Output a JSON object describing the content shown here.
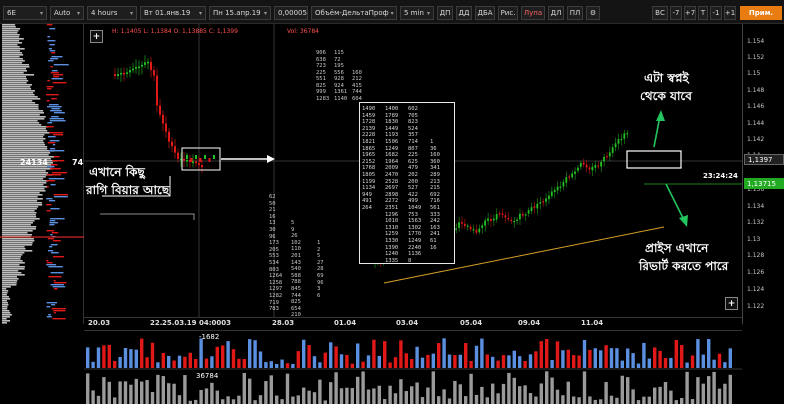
{
  "toolbar": {
    "symbol": "6E",
    "scale": "Auto",
    "period": "4 hours",
    "date_from": "Вт 01.янв.19",
    "date_to": "Пн 15.апр.19",
    "tick": "0,00005",
    "indicator": "Объём-ДельтаПроф",
    "interval": "5 min",
    "buttons": [
      "ДП",
      "ДД",
      "ДБА",
      "Рис.",
      "Лупа",
      "ДЛ",
      "ПЛ",
      "⚙"
    ],
    "active_button": "Лупа",
    "right_buttons": [
      "ВС",
      "-7",
      "+7",
      "T",
      "-1",
      "+1"
    ],
    "apply": "Прим."
  },
  "ohlc": "H: 1,1405 L: 1,1384 O: 1,13885 C: 1,1399",
  "ohlc_vol": "Vol: 36784",
  "profile": {
    "left_value": "24134",
    "right_value": "74"
  },
  "price_axis": {
    "ticks": [
      "1.154",
      "1.152",
      "1.15",
      "1.148",
      "1.146",
      "1.144",
      "1.142",
      "1.14",
      "1.136",
      "1.134",
      "1.132",
      "1.13",
      "1.128",
      "1.126",
      "1.124",
      "1.122"
    ],
    "crosshair_price": "1,1397",
    "current_price": "1,13715",
    "current_price_color": "#22aa22",
    "timer": "23:24:24"
  },
  "date_axis": [
    "20.03",
    "22.",
    "25.03.19 04:0003",
    "28.03",
    "01.04",
    "03.04",
    "05.04",
    "09.04",
    "11.04"
  ],
  "lower_panel": {
    "delta": "-1682",
    "volume": "36784"
  },
  "cluster": {
    "rows": [
      [
        "1490",
        "1400",
        "602",
        ""
      ],
      [
        "1459",
        "1789",
        "705",
        ""
      ],
      [
        "1728",
        "1830",
        "823",
        ""
      ],
      [
        "2139",
        "1449",
        "524",
        ""
      ],
      [
        "2228",
        "1193",
        "357",
        ""
      ],
      [
        "1821",
        "1506",
        "714",
        "1"
      ],
      [
        "1865",
        "1249",
        "807",
        "36"
      ],
      [
        "1965",
        "1682",
        "225",
        "160"
      ],
      [
        "2152",
        "1964",
        "625",
        "360"
      ],
      [
        "1768",
        "2009",
        "479",
        "341"
      ],
      [
        "1805",
        "2470",
        "202",
        "289"
      ],
      [
        "1199",
        "2528",
        "200",
        "213"
      ],
      [
        "1134",
        "2697",
        "527",
        "215"
      ],
      [
        "949",
        "2898",
        "422",
        "692"
      ],
      [
        "491",
        "2272",
        "499",
        "716"
      ],
      [
        "264",
        "2351",
        "1049",
        "561"
      ],
      [
        "",
        "1296",
        "753",
        "333"
      ],
      [
        "",
        "1010",
        "1563",
        "242"
      ],
      [
        "",
        "1310",
        "1302",
        "163"
      ],
      [
        "",
        "1259",
        "1770",
        "241"
      ],
      [
        "",
        "1330",
        "1249",
        "61"
      ],
      [
        "",
        "1390",
        "2240",
        "16"
      ],
      [
        "",
        "1240",
        "1136",
        ""
      ],
      [
        "",
        "1335",
        "8",
        ""
      ]
    ],
    "top_left": [
      "906",
      "638",
      "723",
      "225",
      "551",
      "825",
      "999",
      "1283"
    ],
    "top_right": [
      "115",
      "72",
      "195",
      "556",
      "928",
      "924",
      "1361",
      "1140"
    ],
    "top_far": [
      "",
      "",
      "",
      "160",
      "212",
      "415",
      "744",
      "604"
    ],
    "left_col": [
      "62",
      "50",
      "21",
      "16",
      "13",
      "30",
      "96",
      "173",
      "205",
      "553",
      "534",
      "803",
      "1264",
      "1258",
      "1297",
      "1282",
      "719",
      "783"
    ],
    "mid_col": [
      "5",
      "9",
      "26",
      "102",
      "110",
      "201",
      "143",
      "540",
      "588",
      "788",
      "845",
      "744",
      "825",
      "654",
      "210"
    ],
    "right_col": [
      "1",
      "2",
      "5",
      "27",
      "28",
      "69",
      "96",
      "3",
      "6"
    ]
  },
  "annotations": {
    "left_text": [
      "এখানে কিছু",
      "রাগি বিয়ার আছে"
    ],
    "top_right_text": [
      "এটা স্বপ্নই",
      "থেকে যাবে"
    ],
    "bottom_right_text": [
      "প্রাইস এখানে",
      "রিভার্ট করতে পারে"
    ]
  },
  "colors": {
    "bull": "#22c022",
    "bear": "#e01818",
    "buy_vol": "#5b8fe0",
    "sell_vol": "#e01818",
    "trend": "#d4a020",
    "arrow": "#22c55e",
    "accent": "#e87c10"
  },
  "icons": [
    "plus-icon",
    "plus-icon",
    "gear-icon",
    "dropdown-icon"
  ]
}
